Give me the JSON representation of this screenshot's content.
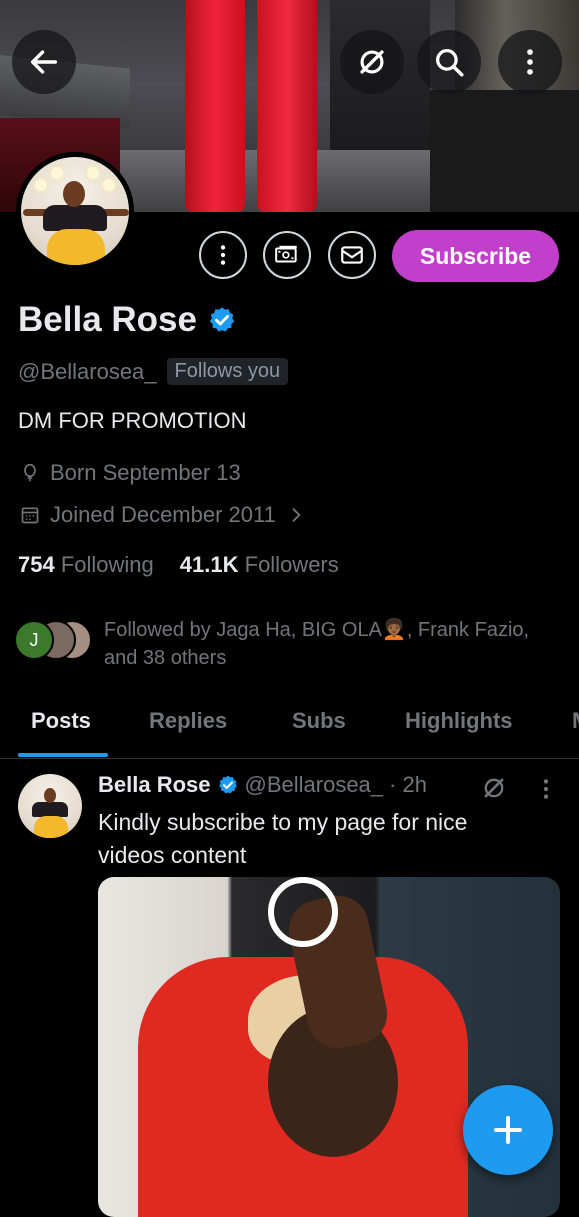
{
  "profile": {
    "name": "Bella Rose",
    "verified": true,
    "handle": "@Bellarosea_",
    "follows_you": "Follows you",
    "bio": "DM FOR PROMOTION",
    "born": "Born September 13",
    "joined": "Joined December 2011",
    "following_count": "754",
    "following_label": "Following",
    "followers_count": "41.1K",
    "followers_label": "Followers",
    "followed_by": "Followed by Jaga Ha, BIG OLA🧑🏾‍🦱, Frank Fazio, and 38 others",
    "followed_by_initial": "J"
  },
  "actions": {
    "subscribe_label": "Subscribe"
  },
  "tabs": [
    {
      "label": "Posts",
      "active": true
    },
    {
      "label": "Replies",
      "active": false
    },
    {
      "label": "Subs",
      "active": false
    },
    {
      "label": "Highlights",
      "active": false
    },
    {
      "label": "M",
      "active": false
    }
  ],
  "post": {
    "author": "Bella Rose",
    "handle": "@Bellarosea_",
    "time": "· 2h",
    "text": "Kindly subscribe to my page for nice videos content"
  },
  "icons": {
    "back": "arrow-left-icon",
    "grok": "grok-icon",
    "search": "search-icon",
    "more": "more-vertical-icon",
    "tip": "money-icon",
    "message": "envelope-icon",
    "verified": "verified-badge-icon",
    "location": "balloon-icon",
    "calendar": "calendar-icon",
    "compose": "plus-icon"
  },
  "colors": {
    "accent": "#1d9bf0",
    "subscribe": "#c23fcb",
    "background": "#000000"
  }
}
